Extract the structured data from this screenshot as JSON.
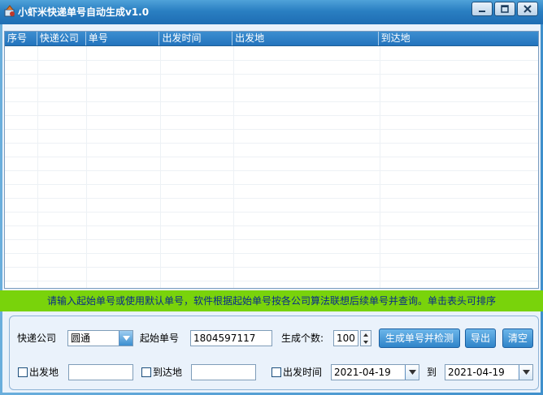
{
  "window": {
    "title": "小虾米快递单号自动生成v1.0",
    "controls": [
      "minimize",
      "maximize",
      "close"
    ]
  },
  "table": {
    "columns": [
      "序号",
      "快递公司",
      "单号",
      "出发时间",
      "出发地",
      "到达地"
    ],
    "rows": []
  },
  "hint": "请输入起始单号或使用默认单号，软件根据起始单号按各公司算法联想后续单号并查询。单击表头可排序",
  "form": {
    "courier_label": "快递公司",
    "courier_value": "圆通",
    "start_label": "起始单号",
    "start_value": "1804597117",
    "count_label": "生成个数:",
    "count_value": "100",
    "generate_button": "生成单号并检测",
    "export_button": "导出",
    "clear_button": "清空",
    "origin_label": "出发地",
    "origin_value": "",
    "dest_label": "到达地",
    "dest_value": "",
    "time_label": "出发时间",
    "date_from": "2021-04-19",
    "to_label": "到",
    "date_to": "2021-04-19"
  },
  "colors": {
    "titlebar": "#2a7fc2",
    "header": "#2374bd",
    "hint_bg": "#79d30b",
    "hint_text": "#0a2a8a",
    "button": "#3a8ccd"
  }
}
